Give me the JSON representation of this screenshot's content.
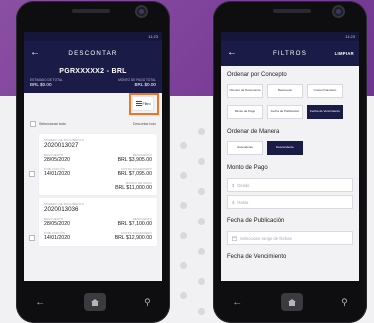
{
  "left": {
    "status_time": "11:23",
    "title": "DESCONTAR",
    "summary": {
      "code": "PGRXXXXX2 - BRL",
      "total_label": "ESTIMADO DE TOTAL",
      "total_value": "BRL $0.00",
      "paid_label": "MONTO DE PAGO TOTAL",
      "paid_value": "BRL $0.00"
    },
    "filter_label": "Filtro",
    "select_all": "Seleccionar todo",
    "discount_all": "Descontar todo",
    "cards": [
      {
        "doc_label": "NÚMERO DE DOCUMENTO",
        "doc_value": "2020013027",
        "discount_label": "DESCUENTO",
        "discount_date": "28/05/2020",
        "discount_amount_label": "DESCUENTO",
        "discount_amount": "BRL $3,905.00",
        "pub_label": "PUBLICACIÓN",
        "pub_date": "14/01/2020",
        "cost_label": "COSTO FINANCIERO",
        "cost_value": "BRL $7,095.00",
        "pay_label": "MONTO DE PAGO",
        "pay_value": "BRL $11,000.00"
      },
      {
        "doc_label": "NÚMERO DE DOCUMENTO",
        "doc_value": "2020013036",
        "discount_label": "DESCUENTO",
        "discount_date": "28/05/2020",
        "discount_amount_label": "DESCUENTO",
        "discount_amount": "BRL $7,100.00",
        "pub_label": "PUBLICACIÓN",
        "pub_date": "14/01/2020",
        "cost_label": "COSTO FINANCIERO",
        "cost_value": "BRL $12,900.00",
        "pay_label": "",
        "pay_value": ""
      }
    ]
  },
  "right": {
    "status_time": "11:23",
    "title": "FILTROS",
    "action": "LIMPIAR",
    "order_concept_title": "Ordenar por Concepto",
    "concept_chips": [
      {
        "label": "Número de Documento",
        "active": false
      },
      {
        "label": "Descuento",
        "active": false
      },
      {
        "label": "Costo Financiero",
        "active": false
      },
      {
        "label": "Monto de Pago",
        "active": false
      },
      {
        "label": "Fecha de Publicación",
        "active": false
      },
      {
        "label": "Fecha de Vencimiento",
        "active": true
      }
    ],
    "order_manner_title": "Ordenar de Manera",
    "manner_chips": [
      {
        "label": "Ascendente",
        "active": false
      },
      {
        "label": "Descendente",
        "active": true
      }
    ],
    "amount_title": "Monto de Pago",
    "from_placeholder": "Desde",
    "to_placeholder": "Hasta",
    "pub_title": "Fecha de Publicación",
    "pub_placeholder": "Seleccione rango de fechas",
    "due_title": "Fecha de Vencimiento"
  },
  "colors": {
    "navy": "#1a1c47",
    "purple": "#7b3f98",
    "highlight": "#f07428"
  }
}
